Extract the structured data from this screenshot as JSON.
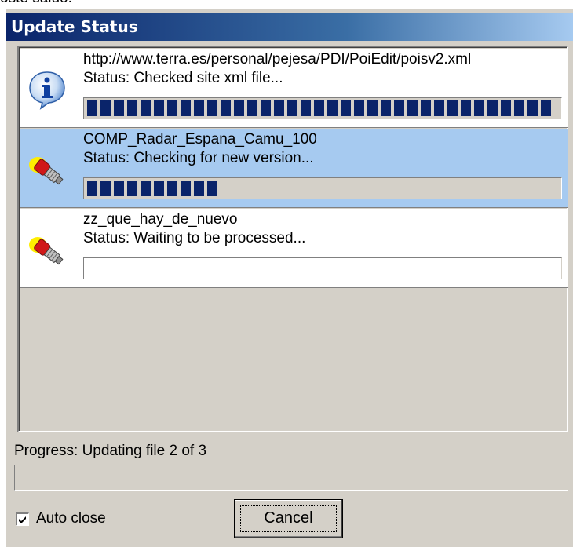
{
  "window": {
    "top_fragment": "oste saluo."
  },
  "titlebar": {
    "title": "Update Status"
  },
  "items": [
    {
      "title": "http://www.terra.es/personal/pejesa/PDI/PoiEdit/poisv2.xml",
      "status": "Status: Checked site xml file...",
      "icon": "info-icon",
      "progress": 1.0,
      "state": "done"
    },
    {
      "title": "COMP_Radar_Espana_Camu_100",
      "status": "Status: Checking for new version...",
      "icon": "plug-icon",
      "progress": 0.3,
      "state": "selected"
    },
    {
      "title": "zz_que_hay_de_nuevo",
      "status": "Status: Waiting to be processed...",
      "icon": "plug-icon",
      "progress": 0.0,
      "state": "waiting"
    }
  ],
  "footer": {
    "progress_label": "Progress: Updating file 2 of 3",
    "overall_progress": 0.0,
    "auto_close_label": "Auto close",
    "auto_close_checked": true,
    "cancel_label": "Cancel"
  },
  "colors": {
    "title_bar_start": "#0a246a",
    "title_bar_end": "#a6caf0",
    "selection": "#a6caf0",
    "progress_fill": "#0a246a",
    "face": "#d4d0c8"
  }
}
